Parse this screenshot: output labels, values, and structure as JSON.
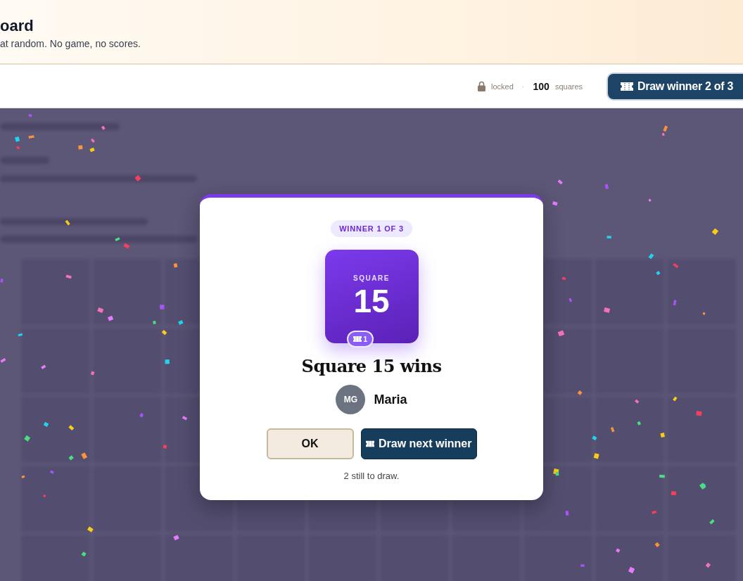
{
  "header": {
    "title": "oard",
    "subtitle": "at random. No game, no scores."
  },
  "toolbar": {
    "lock_state": "locked",
    "separator": "·",
    "count": "100",
    "count_label": "squares",
    "draw_button": {
      "label": "Draw winner 2 of 3"
    }
  },
  "dialog": {
    "badge": "WINNER 1 OF 3",
    "tile": {
      "label": "SQUARE",
      "number": "15",
      "ticket": "1"
    },
    "heading": "Square 15 wins",
    "winner": {
      "initials": "MG",
      "name": "Maria"
    },
    "buttons": [
      {
        "label": "OK",
        "kind": "secondary"
      },
      {
        "label": "Draw next winner",
        "kind": "primary"
      }
    ],
    "note": "2 still to draw."
  }
}
